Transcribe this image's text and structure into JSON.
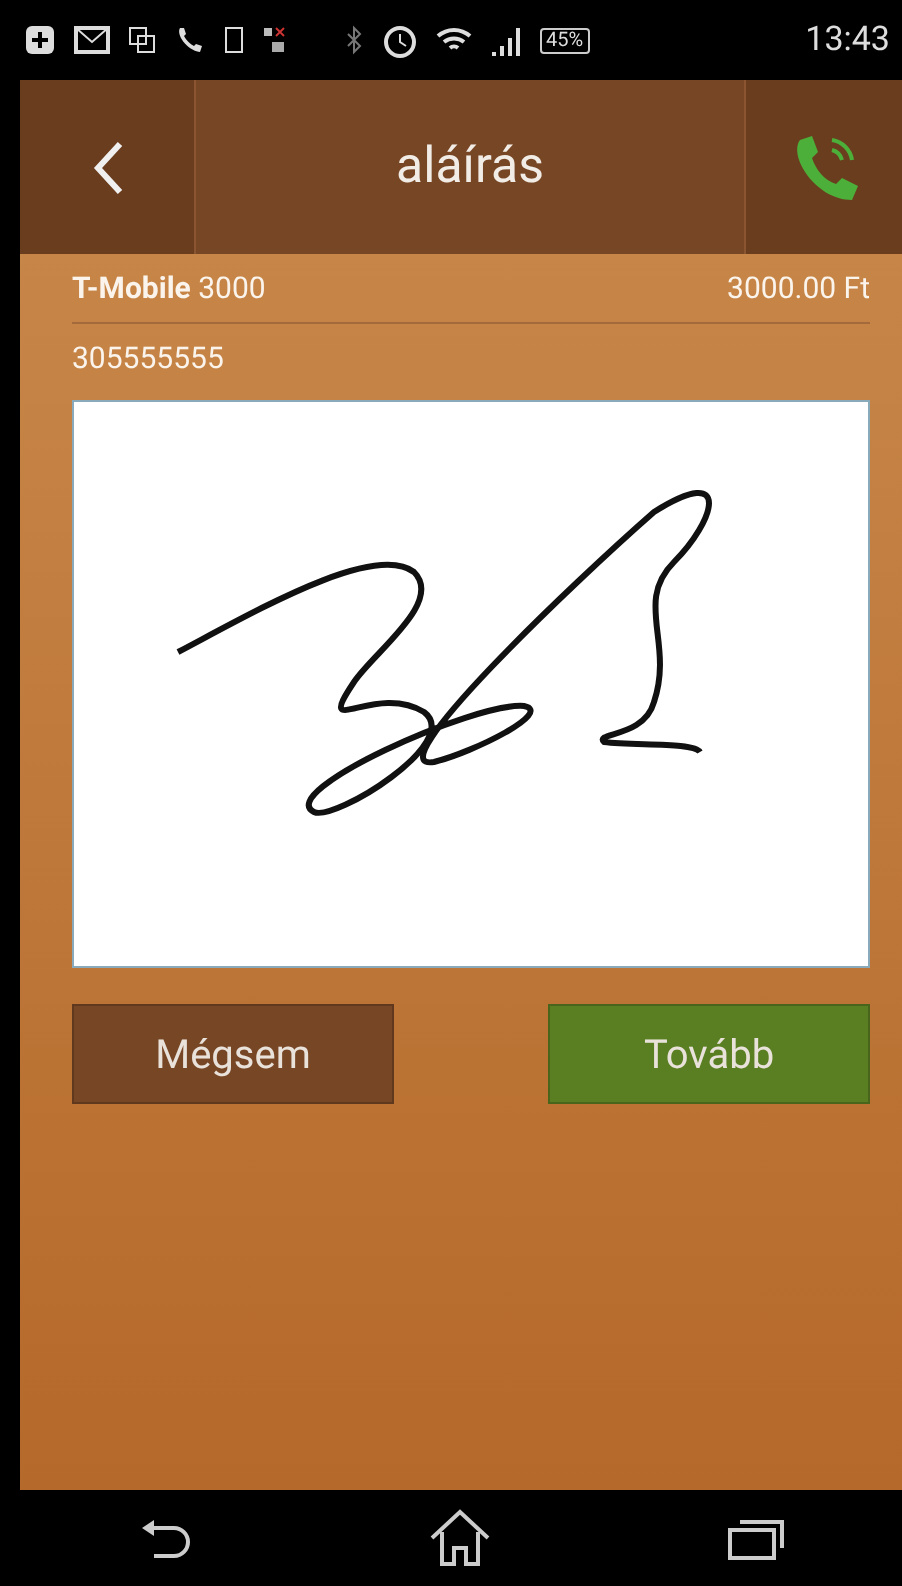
{
  "status_bar": {
    "battery": "45%",
    "time": "13:43"
  },
  "header": {
    "title": "aláírás"
  },
  "order": {
    "product": "**T-Mobile** 3000",
    "amount": "3000.00 Ft",
    "phone": "305555555"
  },
  "buttons": [
    {
      "label": "Mégsem",
      "kind": "cancel"
    },
    {
      "label": "Tovább",
      "kind": "confirm"
    }
  ]
}
